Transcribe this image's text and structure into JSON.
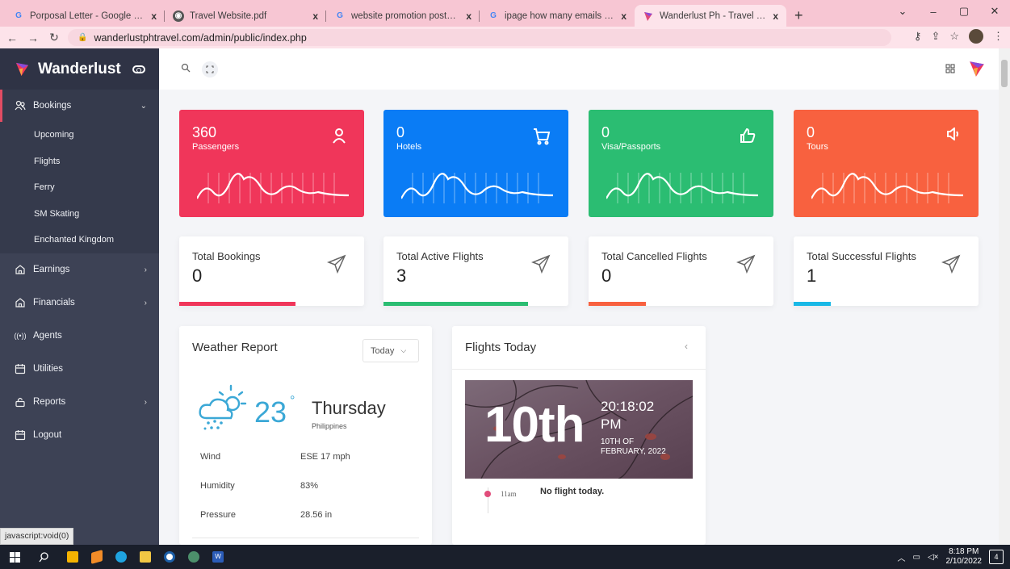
{
  "browser": {
    "tabs": [
      {
        "title": "Porposal Letter - Google Search",
        "favicon": "google-icon",
        "close": "x"
      },
      {
        "title": "Travel Website.pdf",
        "favicon": "globe-icon",
        "close": "x"
      },
      {
        "title": "website promotion poster - Goo",
        "favicon": "google-icon",
        "close": "x"
      },
      {
        "title": "ipage how many emails - Google",
        "favicon": "google-icon",
        "close": "x"
      },
      {
        "title": "Wanderlust Ph - Travel Deals",
        "favicon": "wanderlust-icon",
        "close": "x",
        "active": true
      }
    ],
    "new_tab": "+",
    "url": "wanderlustphtravel.com/admin/public/index.php"
  },
  "sidebar": {
    "brand": "Wanderlust",
    "menu": [
      {
        "label": "Bookings",
        "icon": "users-icon",
        "open": true,
        "chevron": "⌄"
      },
      {
        "label": "Earnings",
        "icon": "home-icon",
        "chevron": "›"
      },
      {
        "label": "Financials",
        "icon": "home-icon",
        "chevron": "›"
      },
      {
        "label": "Agents",
        "icon": "radio-icon"
      },
      {
        "label": "Utilities",
        "icon": "calendar-icon"
      },
      {
        "label": "Reports",
        "icon": "lock-icon",
        "chevron": "›"
      },
      {
        "label": "Logout",
        "icon": "calendar-icon"
      }
    ],
    "submenu": [
      "Upcoming",
      "Flights",
      "Ferry",
      "SM Skating",
      "Enchanted Kingdom"
    ]
  },
  "stats": [
    {
      "value": "360",
      "label": "Passengers",
      "color": "#f0365a",
      "icon": "user-icon"
    },
    {
      "value": "0",
      "label": "Hotels",
      "color": "#0a7cf5",
      "icon": "cart-icon"
    },
    {
      "value": "0",
      "label": "Visa/Passports",
      "color": "#2bbd72",
      "icon": "thumbs-up-icon"
    },
    {
      "value": "0",
      "label": "Tours",
      "color": "#f8613f",
      "icon": "speaker-icon"
    }
  ],
  "totals": [
    {
      "label": "Total Bookings",
      "value": "0",
      "bar_color": "#f0365a",
      "progress": 0.63
    },
    {
      "label": "Total Active Flights",
      "value": "3",
      "bar_color": "#2bbd72",
      "progress": 0.78
    },
    {
      "label": "Total Cancelled Flights",
      "value": "0",
      "bar_color": "#f8613f",
      "progress": 0.31
    },
    {
      "label": "Total Successful Flights",
      "value": "1",
      "bar_color": "#19b8e6",
      "progress": 0.2
    }
  ],
  "weather": {
    "title": "Weather Report",
    "period": "Today",
    "temp": "23",
    "deg": "°",
    "day": "Thursday",
    "location": "Philippines",
    "rows": [
      {
        "label": "Wind",
        "value": "ESE 17 mph"
      },
      {
        "label": "Humidity",
        "value": "83%"
      },
      {
        "label": "Pressure",
        "value": "28.56 in"
      }
    ]
  },
  "flights": {
    "title": "Flights Today",
    "big_date": "10th",
    "time": "20:18:02",
    "ampm": "PM",
    "date_line1": "10TH OF",
    "date_line2": "FEBRUARY, 2022",
    "entry_time": "11am",
    "message": "No flight today."
  },
  "status_link": "javascript:void(0)",
  "taskbar": {
    "time": "8:18 PM",
    "date": "2/10/2022",
    "notifications": "4"
  }
}
